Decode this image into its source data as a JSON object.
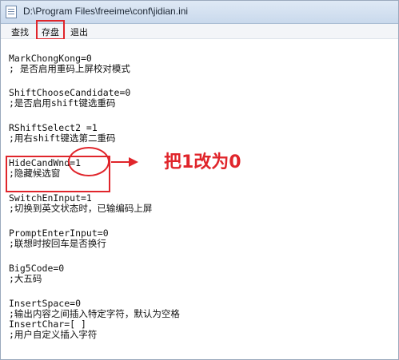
{
  "window": {
    "title": "D:\\Program Files\\freeime\\conf\\jidian.ini"
  },
  "menu": {
    "items": [
      "查找",
      "存盘",
      "退出"
    ]
  },
  "content": {
    "lines": [
      "MarkChongKong=0",
      "; 是否启用重码上屏校对模式",
      "ShiftChooseCandidate=0",
      ";是否启用shift键选重码",
      "RShiftSelect2 =1",
      ";用右shift键选第二重码",
      "HideCandWnd=1",
      ";隐藏候选窗",
      "SwitchEnInput=1",
      ";切换到英文状态时，已输编码上屏",
      "PromptEnterInput=0",
      ";联想时按回车是否换行",
      "Big5Code=0",
      ";大五码",
      "InsertSpace=0",
      ";输出内容之间插入特定字符，默认为空格",
      "InsertChar=[ ]",
      ";用户自定义插入字符"
    ]
  },
  "annotation": {
    "text": "把1改为0"
  },
  "colors": {
    "highlight": "#e0252b",
    "titlebar": "#c9d9ec"
  }
}
